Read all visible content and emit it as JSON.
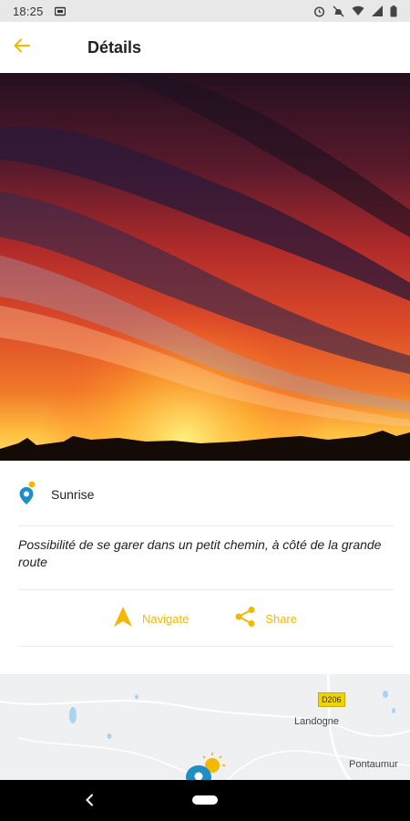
{
  "status_bar": {
    "time": "18:25"
  },
  "app_bar": {
    "title": "Détails",
    "back_icon": "arrow-left-icon"
  },
  "hero": {
    "description": "sunrise-photo"
  },
  "place": {
    "name": "Sunrise",
    "icon": "location-sun-pin-icon"
  },
  "description": "Possibilité de se garer dans un petit chemin, à côté de la grande route",
  "actions": {
    "navigate_label": "Navigate",
    "share_label": "Share"
  },
  "map": {
    "road": "D206",
    "towns": [
      "Landogne",
      "Pontaumur"
    ]
  },
  "colors": {
    "accent": "#f5b800",
    "map_pin": "#1e8fc4"
  }
}
